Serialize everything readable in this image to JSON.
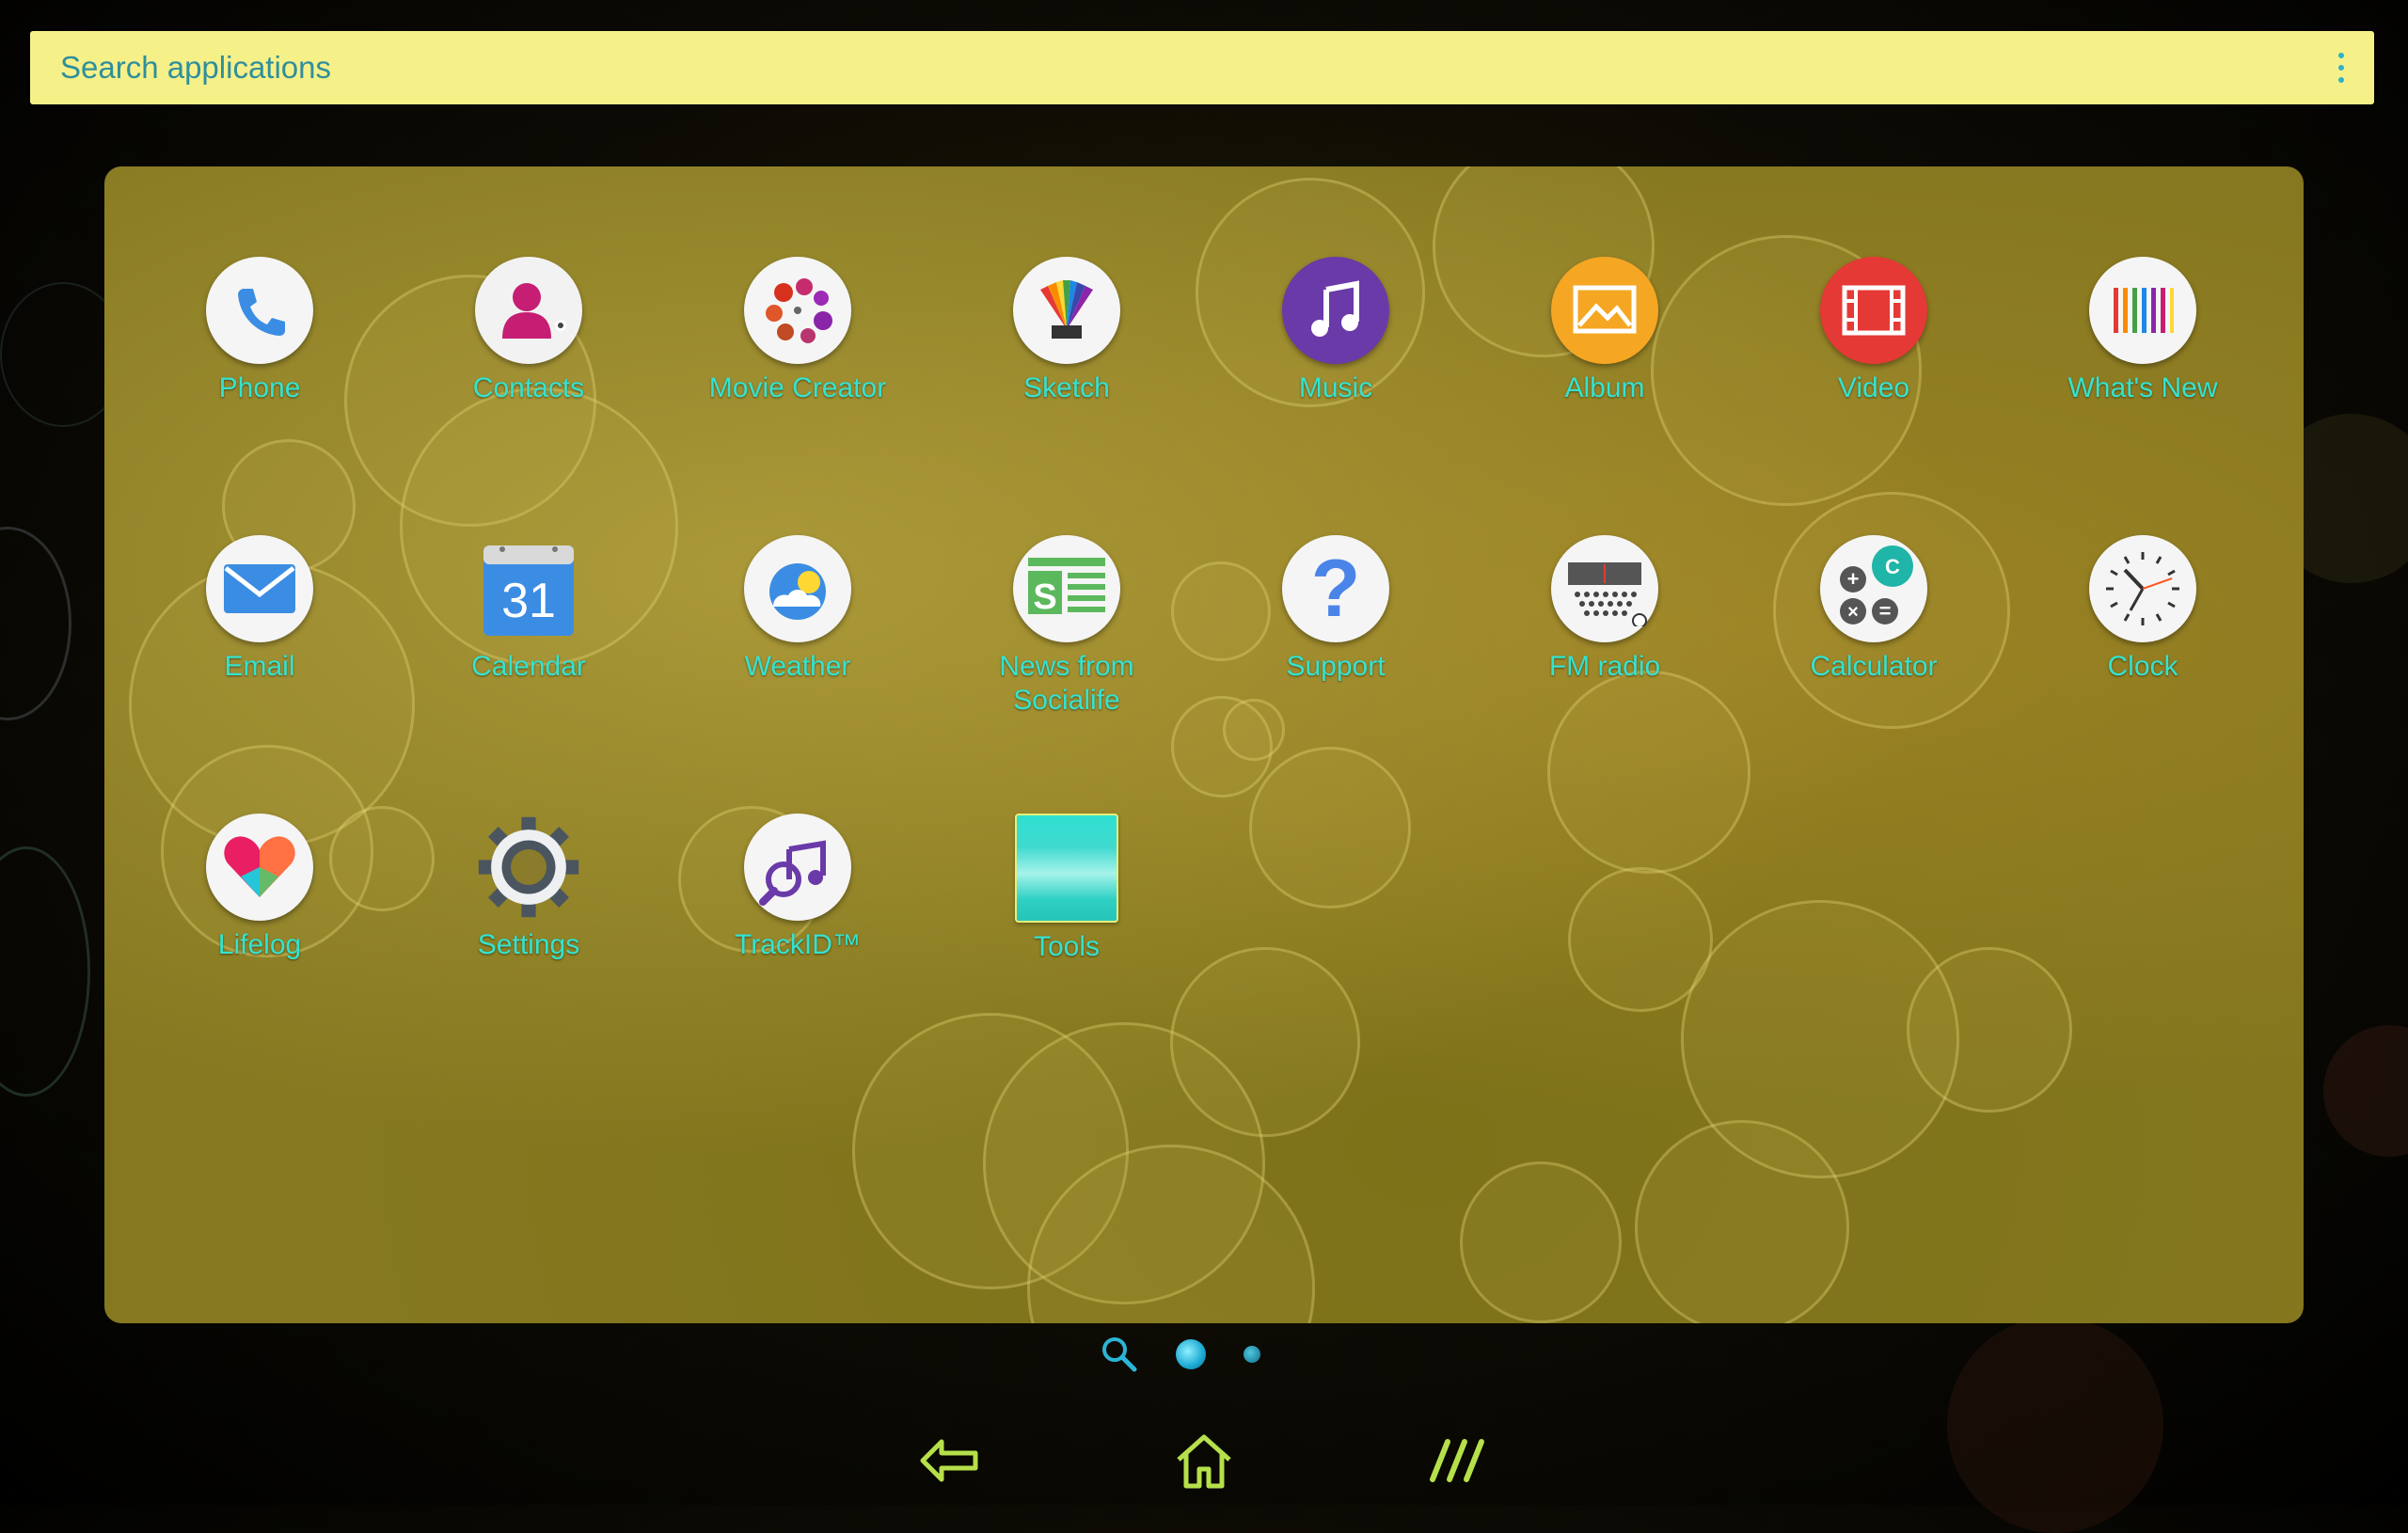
{
  "search": {
    "placeholder": "Search applications",
    "menu_icon": "overflow-menu-icon"
  },
  "apps": [
    {
      "label": "Phone",
      "icon": "phone-icon"
    },
    {
      "label": "Contacts",
      "icon": "contacts-icon"
    },
    {
      "label": "Movie Creator",
      "icon": "movie-creator-icon"
    },
    {
      "label": "Sketch",
      "icon": "sketch-icon"
    },
    {
      "label": "Music",
      "icon": "music-icon"
    },
    {
      "label": "Album",
      "icon": "album-icon"
    },
    {
      "label": "Video",
      "icon": "video-icon"
    },
    {
      "label": "What's New",
      "icon": "whats-new-icon"
    },
    {
      "label": "Email",
      "icon": "email-icon"
    },
    {
      "label": "Calendar",
      "icon": "calendar-icon",
      "badge": "31"
    },
    {
      "label": "Weather",
      "icon": "weather-icon"
    },
    {
      "label": "News from Socialife",
      "icon": "socialife-icon"
    },
    {
      "label": "Support",
      "icon": "support-icon"
    },
    {
      "label": "FM radio",
      "icon": "fm-radio-icon"
    },
    {
      "label": "Calculator",
      "icon": "calculator-icon"
    },
    {
      "label": "Clock",
      "icon": "clock-icon"
    },
    {
      "label": "Lifelog",
      "icon": "lifelog-icon"
    },
    {
      "label": "Settings",
      "icon": "settings-icon"
    },
    {
      "label": "TrackID™",
      "icon": "trackid-icon"
    },
    {
      "label": "Tools",
      "icon": "folder-icon"
    }
  ],
  "page_indicator": {
    "search_icon": "search-icon",
    "pages": 2,
    "current": 1
  },
  "navigation": {
    "back": "back-icon",
    "home": "home-icon",
    "recents": "recents-icon"
  },
  "colors": {
    "accent": "#34e3cf",
    "search_bg": "#f6f089",
    "nav_icon": "#b6e04a"
  }
}
